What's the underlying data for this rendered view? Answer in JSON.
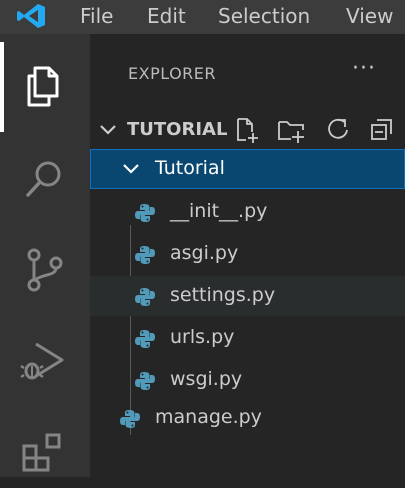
{
  "menu": {
    "items": [
      "File",
      "Edit",
      "Selection",
      "View"
    ]
  },
  "colors": {
    "accent": "#23a9f2",
    "selection": "#094771",
    "python_blue": "#519aba"
  },
  "activity_bar": {
    "items": [
      {
        "icon": "files-icon",
        "active": true
      },
      {
        "icon": "search-icon",
        "active": false
      },
      {
        "icon": "source-control-icon",
        "active": false
      },
      {
        "icon": "run-debug-icon",
        "active": false
      },
      {
        "icon": "extensions-icon",
        "active": false
      }
    ]
  },
  "explorer": {
    "title": "EXPLORER",
    "more": "···",
    "section": {
      "label": "TUTORIAL",
      "actions": [
        "new-file-icon",
        "new-folder-icon",
        "refresh-icon",
        "collapse-all-icon"
      ]
    },
    "tree": {
      "folder": {
        "name": "Tutorial",
        "expanded": true,
        "children": [
          "__init__.py",
          "asgi.py",
          "settings.py",
          "urls.py",
          "wsgi.py"
        ]
      },
      "root_files": [
        "manage.py"
      ]
    }
  }
}
